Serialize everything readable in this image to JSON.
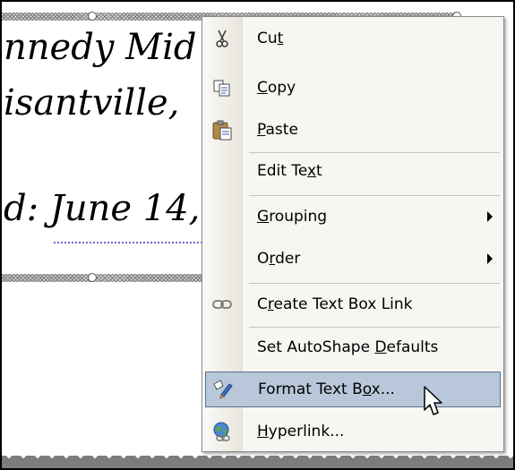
{
  "document": {
    "lines": [
      "nnedy Mid",
      "isantville, ",
      "d: June 14,"
    ]
  },
  "context_menu": {
    "items": [
      {
        "id": "cut",
        "pre": "Cu",
        "key": "t",
        "post": "",
        "icon": "scissors-icon"
      },
      {
        "id": "copy",
        "pre": "",
        "key": "C",
        "post": "opy",
        "icon": "copy-icon"
      },
      {
        "id": "paste",
        "pre": "",
        "key": "P",
        "post": "aste",
        "icon": "paste-icon"
      },
      {
        "id": "edit-text",
        "pre": "Edit Te",
        "key": "x",
        "post": "t",
        "icon": ""
      },
      {
        "id": "grouping",
        "pre": "",
        "key": "G",
        "post": "rouping",
        "icon": "",
        "submenu": true
      },
      {
        "id": "order",
        "pre": "O",
        "key": "r",
        "post": "der",
        "icon": "",
        "submenu": true
      },
      {
        "id": "create-text-box-link",
        "pre": "C",
        "key": "r",
        "post": "eate Text Box Link",
        "icon": "chain-link-icon"
      },
      {
        "id": "set-autoshape-defaults",
        "pre": "Set AutoShape ",
        "key": "D",
        "post": "efaults",
        "icon": ""
      },
      {
        "id": "format-text-box",
        "pre": "Format Text B",
        "key": "o",
        "post": "x...",
        "icon": "format-pen-icon",
        "highlighted": true
      },
      {
        "id": "hyperlink",
        "pre": "",
        "key": "H",
        "post": "yperlink...",
        "icon": "globe-link-icon"
      }
    ]
  },
  "colors": {
    "menu_background": "#f7f6f2",
    "highlight": "#b8c8da",
    "highlight_border": "#5a6f8b"
  }
}
